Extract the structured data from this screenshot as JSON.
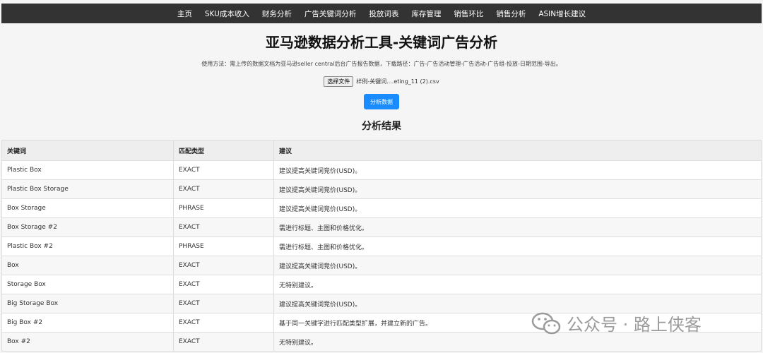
{
  "nav": {
    "items": [
      {
        "label": "主页"
      },
      {
        "label": "SKU成本收入"
      },
      {
        "label": "财务分析"
      },
      {
        "label": "广告关键词分析"
      },
      {
        "label": "投放词表"
      },
      {
        "label": "库存管理"
      },
      {
        "label": "销售环比"
      },
      {
        "label": "销售分析"
      },
      {
        "label": "ASIN增长建议"
      }
    ]
  },
  "header": {
    "title": "亚马逊数据分析工具-关键词广告分析",
    "usage": "使用方法：需上传的数据文档为亚马逊seller central后台广告报告数据，下载路径：广告-广告活动管理-广告活动-广告组-投放-日期范围-导出。"
  },
  "upload": {
    "choose_label": "选择文件",
    "file_name": "样例-关键词....eting_11 (2).csv",
    "analyze_label": "分析数据"
  },
  "results": {
    "title": "分析结果",
    "columns": [
      "关键词",
      "匹配类型",
      "建议"
    ],
    "rows": [
      {
        "keyword": "Plastic Box",
        "match": "EXACT",
        "advice": "建议提高关键词竞价(USD)。"
      },
      {
        "keyword": "Plastic Box Storage",
        "match": "EXACT",
        "advice": "建议提高关键词竞价(USD)。"
      },
      {
        "keyword": "Box Storage",
        "match": "PHRASE",
        "advice": "建议提高关键词竞价(USD)。"
      },
      {
        "keyword": "Box Storage #2",
        "match": "EXACT",
        "advice": "需进行标题、主图和价格优化。"
      },
      {
        "keyword": "Plastic Box #2",
        "match": "PHRASE",
        "advice": "需进行标题、主图和价格优化。"
      },
      {
        "keyword": "Box",
        "match": "EXACT",
        "advice": "建议提高关键词竞价(USD)。"
      },
      {
        "keyword": "Storage Box",
        "match": "EXACT",
        "advice": "无特别建议。"
      },
      {
        "keyword": "Big Storage Box",
        "match": "EXACT",
        "advice": "建议提高关键词竞价(USD)。"
      },
      {
        "keyword": "Big Box #2",
        "match": "EXACT",
        "advice": "基于同一关键字进行匹配类型扩展，并建立新的广告。"
      },
      {
        "keyword": "Box #2",
        "match": "EXACT",
        "advice": "无特别建议。"
      }
    ]
  },
  "watermark": {
    "text": "公众号 · 路上侠客",
    "icon": "wechat-icon"
  }
}
